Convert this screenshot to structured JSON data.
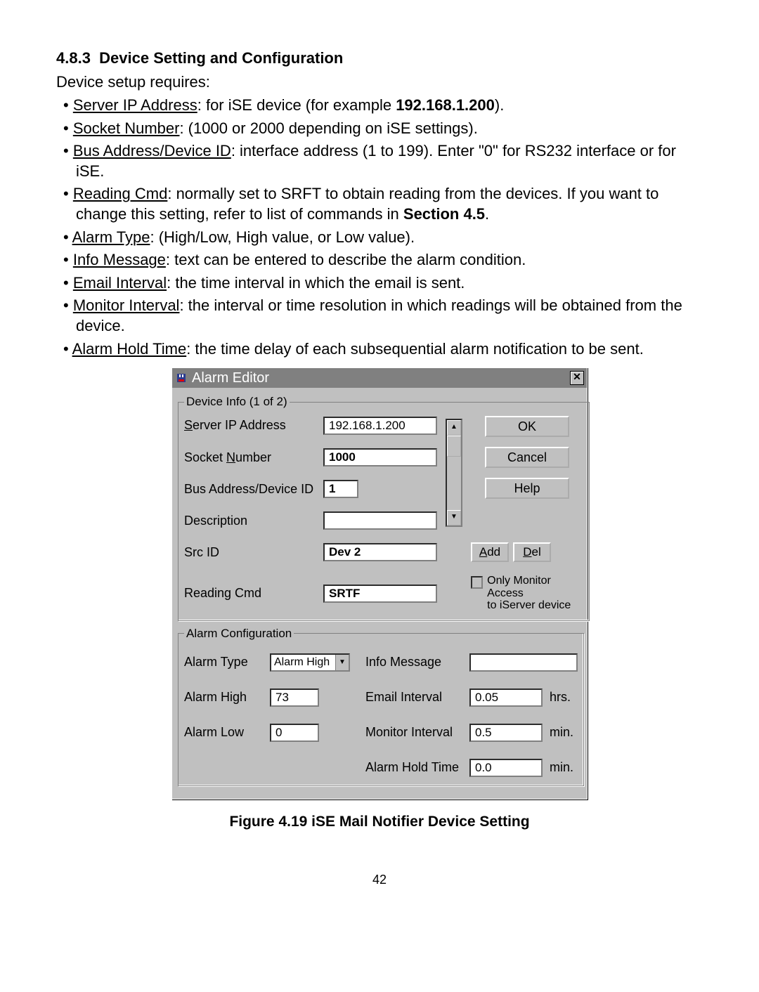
{
  "section": {
    "number": "4.8.3",
    "title": "Device Setting and Configuration",
    "intro": "Device setup requires:",
    "bullets": [
      {
        "label": "Server IP Address",
        "rest": ": for iSE device (for example ",
        "bold": "192.168.1.200",
        "tail": ")."
      },
      {
        "label": "Socket Number",
        "rest": ": (1000 or 2000 depending on iSE settings).",
        "bold": "",
        "tail": ""
      },
      {
        "label": "Bus Address/Device ID",
        "rest": ": interface address (1 to 199).  Enter \"0\" for RS232 interface or for iSE.",
        "bold": "",
        "tail": ""
      },
      {
        "label": "Reading Cmd",
        "rest": ": normally set to  SRFT  to obtain reading from the devices. If you want to change this setting, refer to list of commands in ",
        "bold": "Section 4.5",
        "tail": "."
      },
      {
        "label": "Alarm Type",
        "rest": ": (High/Low, High value, or Low value).",
        "bold": "",
        "tail": ""
      },
      {
        "label": "Info Message",
        "rest": ": text can be entered to describe the alarm condition.",
        "bold": "",
        "tail": ""
      },
      {
        "label": "Email Interval",
        "rest": ": the time interval in which the email is sent.",
        "bold": "",
        "tail": ""
      },
      {
        "label": "Monitor Interval",
        "rest": ": the interval or time resolution in which readings will be obtained from the device.",
        "bold": "",
        "tail": ""
      },
      {
        "label": "Alarm Hold Time",
        "rest": ": the time delay of each subsequential alarm notification to be sent.",
        "bold": "",
        "tail": ""
      }
    ]
  },
  "dialog": {
    "title": "Alarm Editor",
    "group1_legend": "Device Info  (1 of 2)",
    "labels": {
      "server_ip": "Server IP Address",
      "socket": "Socket Number",
      "bus": "Bus Address/Device ID",
      "desc": "Description",
      "src": "Src ID",
      "rcmd": "Reading Cmd"
    },
    "values": {
      "server_ip": "192.168.1.200",
      "socket": "1000",
      "bus": "1",
      "desc": "",
      "src": "Dev 2",
      "rcmd": "SRTF"
    },
    "buttons": {
      "ok": "OK",
      "cancel": "Cancel",
      "help": "Help",
      "add": "Add",
      "del": "Del"
    },
    "mnemonics": {
      "server_u": "S",
      "server_rest": "erver IP Address",
      "socket_pre": "Socket ",
      "socket_u": "N",
      "socket_rest": "umber",
      "add_u": "A",
      "add_rest": "dd",
      "del_u": "D",
      "del_rest": "el"
    },
    "checkbox": {
      "line1": "Only Monitor Access",
      "line2": "to iServer device"
    },
    "group2_legend": "Alarm Configuration",
    "alarm": {
      "type_label": "Alarm Type",
      "type_value": "Alarm High",
      "high_label": "Alarm High",
      "high_value": "73",
      "low_label": "Alarm Low",
      "low_value": "0",
      "info_label": "Info Message",
      "info_value": "",
      "email_label": "Email Interval",
      "email_value": "0.05",
      "email_unit": "hrs.",
      "mon_label": "Monitor Interval",
      "mon_value": "0.5",
      "mon_unit": "min.",
      "hold_label": "Alarm Hold Time",
      "hold_value": "0.0",
      "hold_unit": "min."
    }
  },
  "figure_caption": "Figure 4.19  iSE Mail Notifier Device Setting",
  "page_number": "42"
}
